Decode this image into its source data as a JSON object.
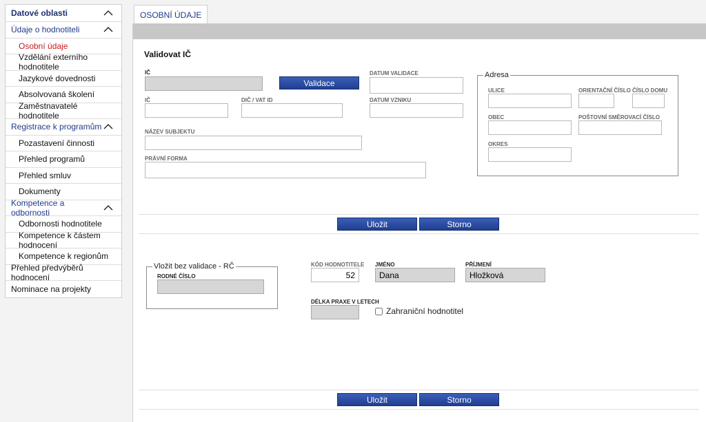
{
  "sidebar": {
    "header": "Datové oblasti",
    "groups": [
      {
        "label": "Údaje o hodnotiteli",
        "items": [
          "Osobní údaje",
          "Vzdělání externího hodnotitele",
          "Jazykové dovednosti",
          "Absolvovaná školení",
          "Zaměstnavatelé hodnotitele"
        ]
      },
      {
        "label": "Registrace k programům",
        "items": [
          "Pozastavení činnosti",
          "Přehled programů",
          "Přehled smluv",
          "Dokumenty"
        ]
      },
      {
        "label": "Kompetence a odbornosti",
        "items": [
          "Odbornosti hodnotitele",
          "Kompetence k částem hodnocení",
          "Kompetence k regionům"
        ]
      }
    ],
    "plain_items": [
      "Přehled předvýběrů hodnocení",
      "Nominace na projekty"
    ],
    "active_item": "Osobní údaje"
  },
  "tab": {
    "label": "OSOBNÍ ÚDAJE"
  },
  "validate_section": {
    "title": "Validovat IČ",
    "ic_label": "IČ",
    "ic_value": "",
    "validate_button": "Validace",
    "datum_validace_label": "DATUM VALIDACE",
    "datum_validace_value": "",
    "ic2_label": "IČ",
    "ic2_value": "",
    "dic_label": "DIČ / VAT ID",
    "dic_value": "",
    "datum_vzniku_label": "DATUM VZNIKU",
    "datum_vzniku_value": "",
    "nazev_label": "NÁZEV SUBJEKTU",
    "nazev_value": "",
    "pravni_forma_label": "PRÁVNÍ FORMA",
    "pravni_forma_value": ""
  },
  "address": {
    "legend": "Adresa",
    "ulice_label": "ULICE",
    "ulice_value": "",
    "orientacni_label": "ORIENTAČNÍ ČÍSLO",
    "orientacni_value": "",
    "cislo_domu_label": "ČÍSLO DOMU",
    "cislo_domu_value": "",
    "obec_label": "OBEC",
    "obec_value": "",
    "psc_label": "POŠTOVNÍ SMĚROVACÍ ČÍSLO",
    "psc_value": "",
    "okres_label": "OKRES",
    "okres_value": ""
  },
  "actions": {
    "save": "Uložit",
    "cancel": "Storno"
  },
  "rc_section": {
    "legend": "Vložit bez validace - RČ",
    "rodne_cislo_label": "RODNÉ ČÍSLO",
    "rodne_cislo_value": ""
  },
  "person": {
    "kod_label": "KÓD HODNOTITELE",
    "kod_value": "52",
    "jmeno_label": "JMÉNO",
    "jmeno_value": "Dana",
    "prijmeni_label": "PŘÍJMENÍ",
    "prijmeni_value": "Hložková",
    "praxe_label": "DÉLKA PRAXE V LETECH",
    "praxe_value": "",
    "zahranicni_label": "Zahraniční hodnotitel",
    "zahranicni_checked": false
  }
}
